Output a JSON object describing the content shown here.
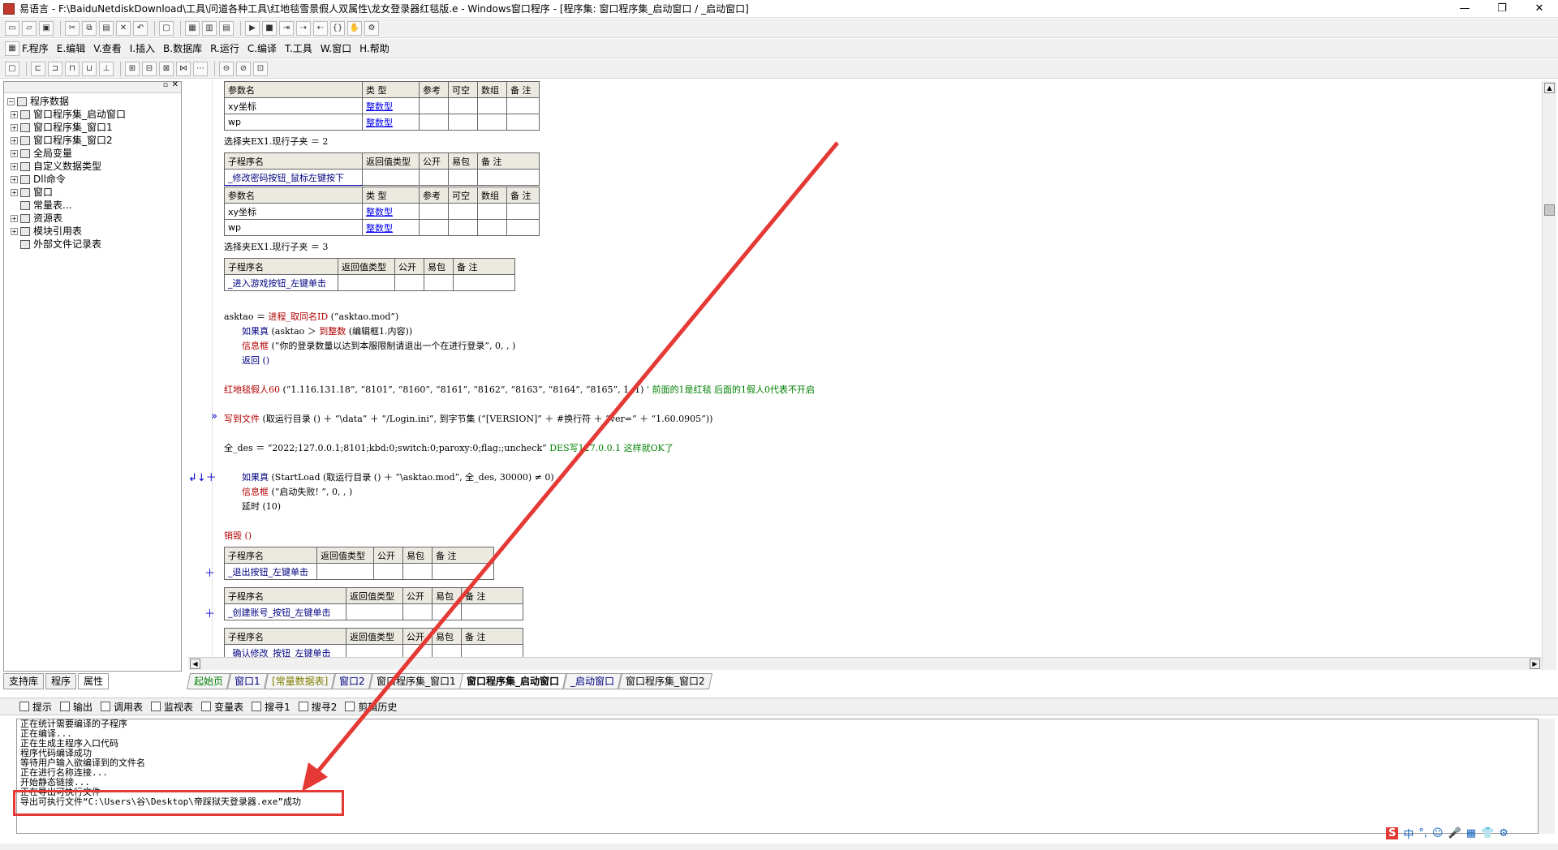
{
  "window": {
    "title": "易语言 - F:\\BaiduNetdiskDownload\\工具\\问道各种工具\\红地毯雪景假人双属性\\龙女登录器红毯版.e - Windows窗口程序 - [程序集: 窗口程序集_启动窗口 / _启动窗口]",
    "min": "—",
    "max": "❐",
    "close": "✕"
  },
  "menu": [
    "F.程序",
    "E.编辑",
    "V.查看",
    "I.插入",
    "B.数据库",
    "R.运行",
    "C.编译",
    "T.工具",
    "W.窗口",
    "H.帮助"
  ],
  "tree": {
    "root": "程序数据",
    "items": [
      "窗口程序集_启动窗口",
      "窗口程序集_窗口1",
      "窗口程序集_窗口2",
      "全局变量",
      "自定义数据类型",
      "Dll命令",
      "窗口",
      "常量表...",
      "资源表",
      "模块引用表",
      "外部文件记录表"
    ]
  },
  "left_tabs": [
    "支持库",
    "程序",
    "属性"
  ],
  "editor": {
    "params_header": [
      "参数名",
      "类 型",
      "参考",
      "可空",
      "数组",
      "备 注"
    ],
    "sub_header": [
      "子程序名",
      "返回值类型",
      "公开",
      "易包",
      "备 注"
    ],
    "p1": [
      "xy坐标",
      "整数型"
    ],
    "p2": [
      "wp",
      "整数型"
    ],
    "sel2": "选择夹EX1.现行子夹 ＝ 2",
    "sub2": "_修改密码按钮_鼠标左键按下",
    "p3": [
      "xy坐标",
      "整数型"
    ],
    "p4": [
      "wp",
      "整数型"
    ],
    "sel3": "选择夹EX1.现行子夹 ＝ 3",
    "sub3": "_进入游戏按钮_左键单击",
    "c1a": "asktao ＝ ",
    "c1b": "进程_取同名ID",
    "c1c": " (“asktao.mod”)",
    "c2a": "如果真",
    "c2b": " (asktao ＞ ",
    "c2c": "到整数",
    "c2d": " (编辑框1.内容))",
    "c3a": "信息框",
    "c3b": " (“你的登录数量以达到本服限制请退出一个在进行登录”, 0, , )",
    "c4": "返回 ()",
    "c5a": "红地毯假人60",
    "c5b": " (“1.116.131.18”, “8101”, “8160”, “8161”, “8162”, “8163”, “8164”, “8165”, 1, 1)",
    "c5c": "  ' 前面的1是红毯 后面的1假人0代表不开启",
    "c6a": "写到文件",
    "c6b": " (取运行目录 () ＋ “\\data” ＋ “/Login.ini”, 到字节集 (“[VERSION]” ＋ #换行符 ＋ “ver=” ＋ “1.60.0905”))",
    "c7a": "全_des ＝ “2022;127.0.0.1;8101;kbd:0;switch:0;paroxy:0;flag:;uncheck”",
    "c7b": "  DES写127.0.0.1  这样就OK了",
    "c8a": "如果真",
    "c8b": " (StartLoad (取运行目录 () ＋ “\\asktao.mod”, 全_des, 30000) ≠ 0)",
    "c9a": "信息框",
    "c9b": " (“启动失败! ”, 0, , )",
    "c10": "延时 (10)",
    "c11": "销毁 ()",
    "sub4": "_退出按钮_左键单击",
    "sub5": "_创建账号_按钮_左键单击",
    "sub6": "_确认修改_按钮_左键单击",
    "mark_a": "»",
    "mark_b": "↲↓＋",
    "mark_c": "＋"
  },
  "doc_tabs": [
    "起始页",
    "窗口1",
    "[常量数据表]",
    "窗口2",
    "窗口程序集_窗口1",
    "窗口程序集_启动窗口",
    "_启动窗口",
    "窗口程序集_窗口2"
  ],
  "out_tabs": [
    "提示",
    "输出",
    "调用表",
    "监视表",
    "变量表",
    "搜寻1",
    "搜寻2",
    "剪辑历史"
  ],
  "output": [
    "正在统计需要编译的子程序",
    "正在编译...",
    "正在生成主程序入口代码",
    "程序代码编译成功",
    "等待用户输入欲编译到的文件名",
    "正在进行名称连接...",
    "开始静态链接...",
    "正在导出可执行文件",
    "导出可执行文件“C:\\Users\\谷\\Desktop\\帝踩狱天登录器.exe”成功"
  ],
  "tray": [
    "S",
    "中",
    "°,",
    "☺",
    "🎤",
    "▦",
    "👕",
    "⚙"
  ],
  "colors": {
    "accent_red": "#e53935",
    "link_blue": "#0000ee",
    "keyword_red": "#b00000",
    "comment_green": "#008000"
  }
}
